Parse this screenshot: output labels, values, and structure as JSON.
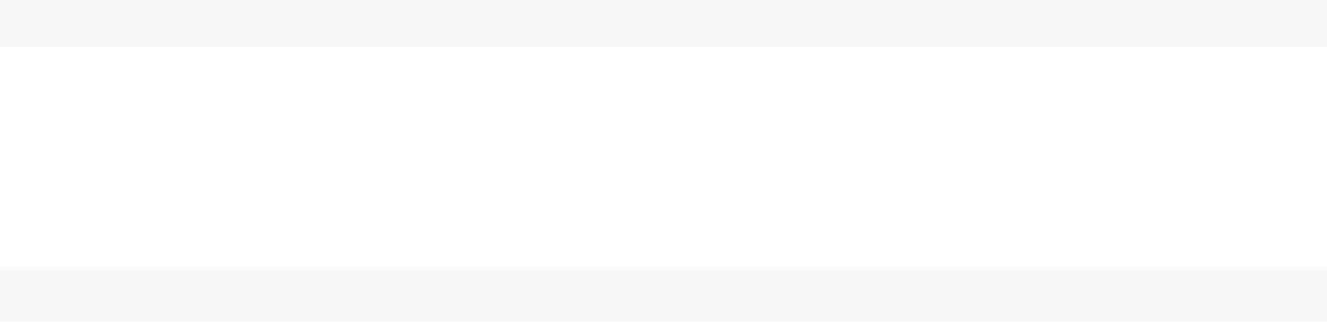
{
  "colors": {
    "bar_background": "#f7f7f7",
    "content_background": "#ffffff",
    "divider": "#fbfbfb"
  }
}
